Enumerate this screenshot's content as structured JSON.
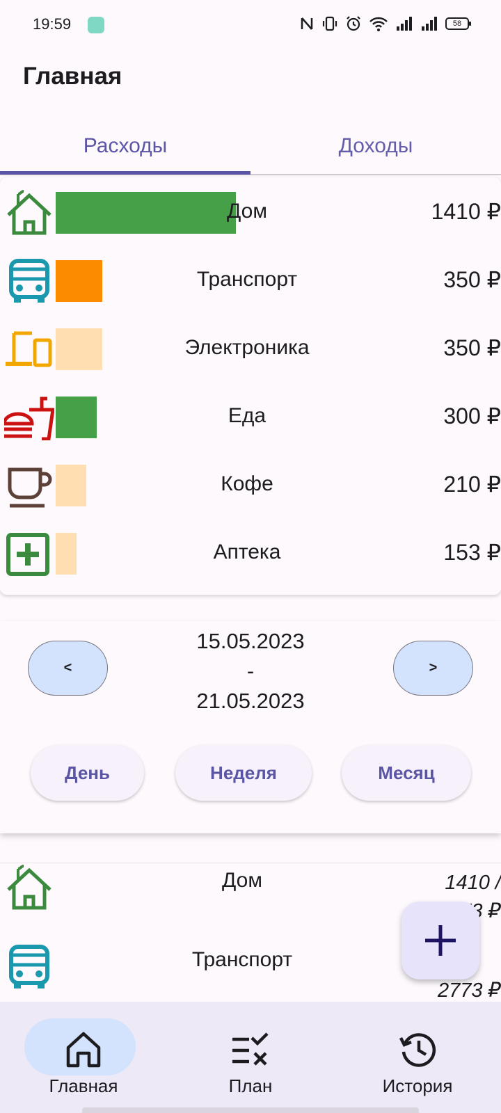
{
  "status_bar": {
    "time": "19:59",
    "battery": "58"
  },
  "header": {
    "title": "Главная"
  },
  "tabs": [
    {
      "label": "Расходы",
      "selected": true
    },
    {
      "label": "Доходы",
      "selected": false
    }
  ],
  "categories": [
    {
      "name": "Дом",
      "amount": "1410 ₽",
      "icon": "house-icon",
      "icon_color": "#3b8a3e",
      "bar_color": "#46a047",
      "share": 0.35
    },
    {
      "name": "Транспорт",
      "amount": "350 ₽",
      "icon": "bus-icon",
      "icon_color": "#1a98ad",
      "bar_color": "#fb8c00",
      "share": 0.09
    },
    {
      "name": "Электроника",
      "amount": "350 ₽",
      "icon": "devices-icon",
      "icon_color": "#f2a600",
      "bar_color": "#ffdfb2",
      "share": 0.09
    },
    {
      "name": "Еда",
      "amount": "300 ₽",
      "icon": "fastfood-icon",
      "icon_color": "#cc1111",
      "bar_color": "#46a047",
      "share": 0.08
    },
    {
      "name": "Кофе",
      "amount": "210 ₽",
      "icon": "coffee-icon",
      "icon_color": "#5d4037",
      "bar_color": "#ffdfb2",
      "share": 0.06
    },
    {
      "name": "Аптека",
      "amount": "153 ₽",
      "icon": "pharmacy-icon",
      "icon_color": "#3b8a3e",
      "bar_color": "#ffdfb2",
      "share": 0.04
    }
  ],
  "period": {
    "prev_label": "<",
    "next_label": ">",
    "start": "15.05.2023",
    "separator": "-",
    "end": "21.05.2023",
    "ranges": {
      "day": "День",
      "week": "Неделя",
      "month": "Месяц"
    }
  },
  "plan": [
    {
      "name": "Дом",
      "amount_line1": "1410 /",
      "amount_line2": "2773 ₽",
      "icon": "house-icon"
    },
    {
      "name": "Транспорт",
      "amount_line1": "",
      "amount_line2": "2773 ₽",
      "icon": "bus-icon"
    }
  ],
  "fab": {
    "icon": "plus-icon"
  },
  "bottom_nav": [
    {
      "label": "Главная",
      "icon": "home-icon",
      "selected": true
    },
    {
      "label": "План",
      "icon": "checklist-icon",
      "selected": false
    },
    {
      "label": "История",
      "icon": "history-icon",
      "selected": false
    }
  ],
  "colors": {
    "accent": "#5b55a6",
    "pill": "#d3e3fd",
    "background": "#fdf9fd"
  }
}
